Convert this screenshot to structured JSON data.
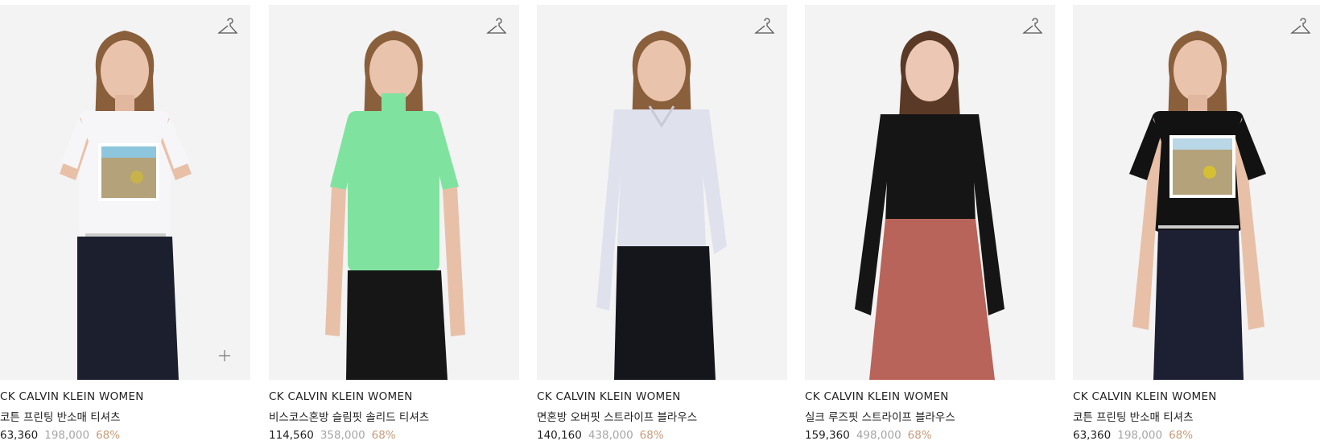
{
  "products": [
    {
      "brand": "CK CALVIN KLEIN WOMEN",
      "name": "코튼 프린팅 반소매 티셔츠",
      "sale_price": "63,360",
      "original_price": "198,000",
      "discount": "68%",
      "top_color": "#f6f5f7",
      "bottom_color": "#1c1f2d",
      "print": true,
      "show_add": true
    },
    {
      "brand": "CK CALVIN KLEIN WOMEN",
      "name": "비스코스혼방 슬림핏 솔리드 티셔츠",
      "sale_price": "114,560",
      "original_price": "358,000",
      "discount": "68%",
      "top_color": "#7fe39f",
      "bottom_color": "#161616",
      "print": false,
      "show_add": false
    },
    {
      "brand": "CK CALVIN KLEIN WOMEN",
      "name": "면혼방 오버핏 스트라이프 블라우스",
      "sale_price": "140,160",
      "original_price": "438,000",
      "discount": "68%",
      "top_color": "#dfe1ec",
      "bottom_color": "#15161c",
      "print": false,
      "show_add": false
    },
    {
      "brand": "CK CALVIN KLEIN WOMEN",
      "name": "실크 루즈핏 스트라이프 블라우스",
      "sale_price": "159,360",
      "original_price": "498,000",
      "discount": "68%",
      "top_color": "#151515",
      "bottom_color": "#b9645a",
      "print": false,
      "show_add": false
    },
    {
      "brand": "CK CALVIN KLEIN WOMEN",
      "name": "코튼 프린팅 반소매 티셔츠",
      "sale_price": "63,360",
      "original_price": "198,000",
      "discount": "68%",
      "top_color": "#121212",
      "bottom_color": "#1d2033",
      "print": true,
      "show_add": false
    }
  ],
  "icons": {
    "wishlist": "hanger-icon",
    "add": "plus-icon"
  }
}
